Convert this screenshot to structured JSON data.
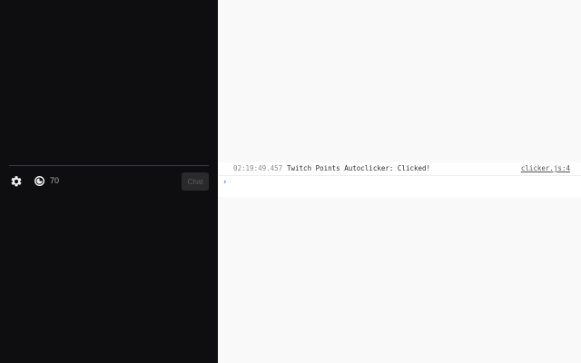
{
  "chat": {
    "points_value": "70",
    "chat_button_label": "Chat",
    "settings_icon": "gear-icon",
    "points_icon": "channel-points-icon"
  },
  "console": {
    "log": {
      "timestamp": "02:19:49.457",
      "message": "Twitch Points Autoclicker: Clicked!",
      "source": "clicker.js:4"
    },
    "prompt_symbol": "›"
  },
  "colors": {
    "chat_bg": "#0e0e10",
    "console_bg": "#f9f9f9",
    "prompt_accent": "#3a7bd5"
  }
}
